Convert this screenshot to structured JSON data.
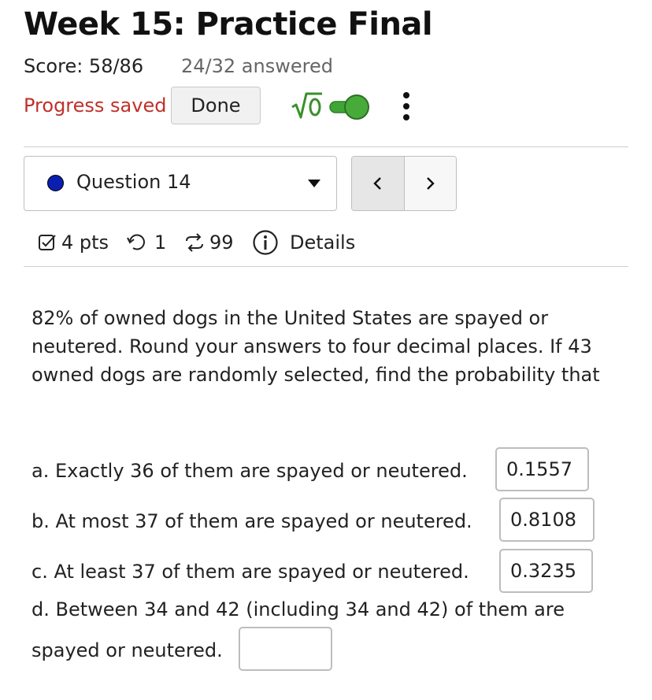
{
  "assignment": {
    "title": "Week 15: Practice Final",
    "score": "Score: 58/86",
    "answered": "24/32 answered",
    "progress_status": "Progress saved",
    "done_label": "Done",
    "math_toggle_icon": "sqrt-zero-icon",
    "toggle_on": true,
    "accent_color": "#3fa535"
  },
  "question_nav": {
    "selected_question": "Question 14",
    "status_dot_color": "#0a1fb0",
    "prev_label": "<",
    "next_label": ">"
  },
  "question_meta": {
    "points": "4 pts",
    "attempts": "1",
    "versions": "99",
    "details_label": "Details"
  },
  "problem": {
    "text": "82% of owned dogs in the United States are spayed or neutered. Round your answers to four decimal places. If 43 owned dogs are randomly selected, find the probability that",
    "parts": [
      {
        "label": "a. Exactly 36 of them are spayed or neutered.",
        "answer": "0.1557"
      },
      {
        "label": "b. At most 37 of them are spayed or neutered.",
        "answer": "0.8108"
      },
      {
        "label": "c. At least 37 of them are spayed or neutered.",
        "answer": "0.3235"
      },
      {
        "label": "d. Between 34 and 42 (including 34 and 42) of them are",
        "label_cont": "spayed or neutered.",
        "answer": ""
      }
    ]
  }
}
